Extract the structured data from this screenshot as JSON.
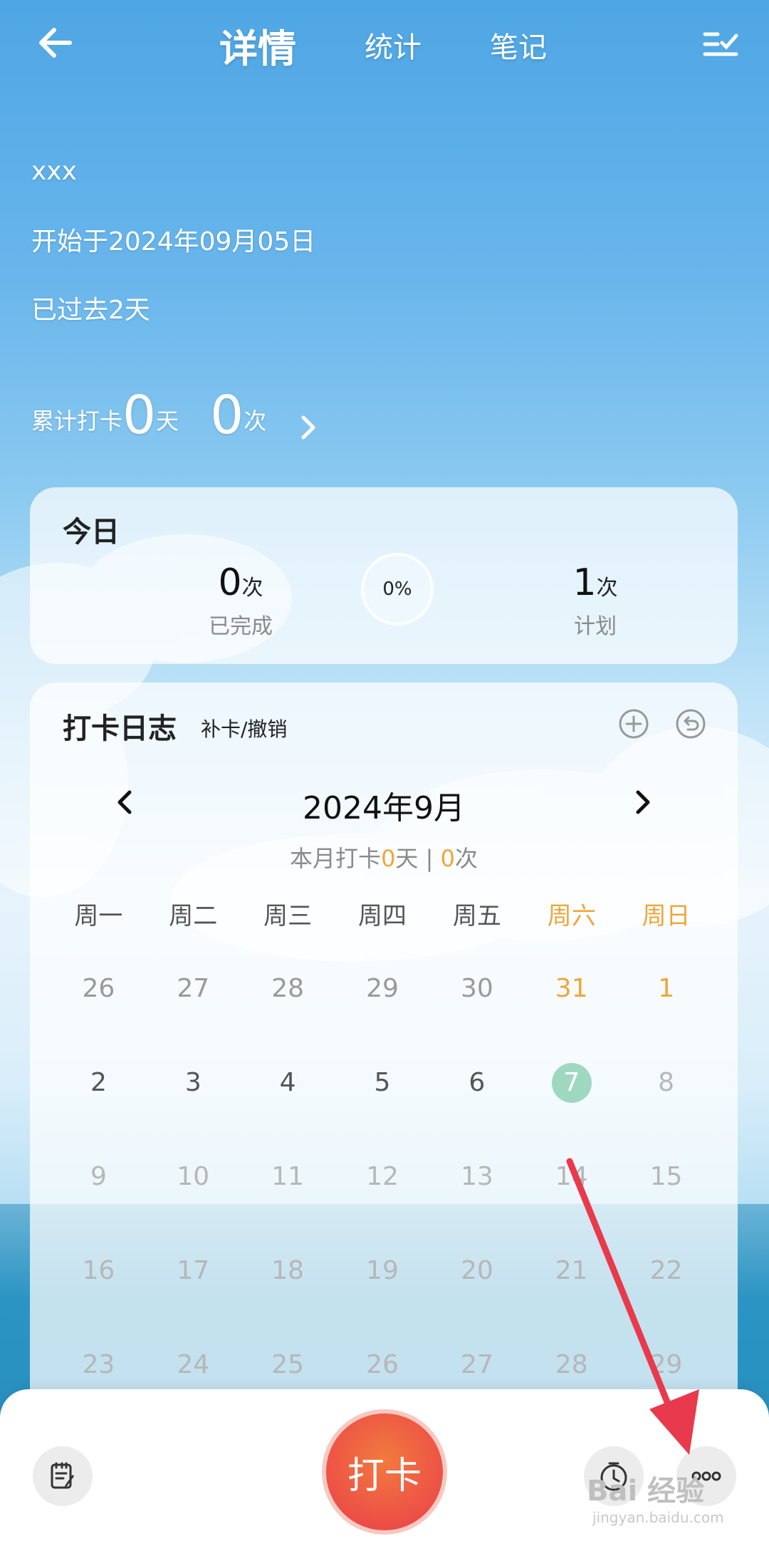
{
  "header": {
    "tabs": [
      {
        "label": "详情",
        "active": true
      },
      {
        "label": "统计",
        "active": false
      },
      {
        "label": "笔记",
        "active": false
      }
    ]
  },
  "habit": {
    "name": "xxx",
    "start_text": "开始于2024年09月05日",
    "elapsed_text": "已过去2天"
  },
  "cumulative": {
    "label": "累计打卡",
    "days": "0",
    "days_unit": "天",
    "times": "0",
    "times_unit": "次"
  },
  "today": {
    "title": "今日",
    "completed_value": "0",
    "completed_unit": "次",
    "completed_label": "已完成",
    "progress": "0%",
    "plan_value": "1",
    "plan_unit": "次",
    "plan_label": "计划"
  },
  "log": {
    "title": "打卡日志",
    "subtitle": "补卡/撤销",
    "month": "2024年9月",
    "summary_prefix": "本月打卡",
    "summary_days": "0",
    "summary_days_unit": "天 | ",
    "summary_times": "0",
    "summary_times_unit": "次",
    "weekdays": [
      "周一",
      "周二",
      "周三",
      "周四",
      "周五",
      "周六",
      "周日"
    ],
    "days": [
      {
        "d": "26",
        "type": "prev"
      },
      {
        "d": "27",
        "type": "prev"
      },
      {
        "d": "28",
        "type": "prev"
      },
      {
        "d": "29",
        "type": "prev"
      },
      {
        "d": "30",
        "type": "prev"
      },
      {
        "d": "31",
        "type": "prev"
      },
      {
        "d": "1",
        "type": "cur"
      },
      {
        "d": "2",
        "type": "cur"
      },
      {
        "d": "3",
        "type": "cur"
      },
      {
        "d": "4",
        "type": "cur"
      },
      {
        "d": "5",
        "type": "cur"
      },
      {
        "d": "6",
        "type": "cur"
      },
      {
        "d": "7",
        "type": "today"
      },
      {
        "d": "8",
        "type": "fut"
      },
      {
        "d": "9",
        "type": "fut"
      },
      {
        "d": "10",
        "type": "fut"
      },
      {
        "d": "11",
        "type": "fut"
      },
      {
        "d": "12",
        "type": "fut"
      },
      {
        "d": "13",
        "type": "fut"
      },
      {
        "d": "14",
        "type": "fut"
      },
      {
        "d": "15",
        "type": "fut"
      },
      {
        "d": "16",
        "type": "fut"
      },
      {
        "d": "17",
        "type": "fut"
      },
      {
        "d": "18",
        "type": "fut"
      },
      {
        "d": "19",
        "type": "fut"
      },
      {
        "d": "20",
        "type": "fut"
      },
      {
        "d": "21",
        "type": "fut"
      },
      {
        "d": "22",
        "type": "fut"
      },
      {
        "d": "23",
        "type": "fut"
      },
      {
        "d": "24",
        "type": "fut"
      },
      {
        "d": "25",
        "type": "fut"
      },
      {
        "d": "26",
        "type": "fut"
      },
      {
        "d": "27",
        "type": "fut"
      },
      {
        "d": "28",
        "type": "fut"
      },
      {
        "d": "29",
        "type": "fut"
      }
    ]
  },
  "bottom_bar": {
    "checkin_label": "打卡"
  },
  "watermark": {
    "brand": "Bai 经验",
    "url": "jingyan.baidu.com"
  },
  "colors": {
    "accent_weekend": "#f0a63a",
    "today_circle": "#9fd8c0",
    "checkin_start": "#f27a3e",
    "checkin_end": "#ea3d4a"
  },
  "icons": [
    "back-arrow-icon",
    "checklist-icon",
    "chevron-right-icon",
    "plus-circle-icon",
    "undo-circle-icon",
    "chevron-left-icon",
    "note-icon",
    "clock-icon",
    "more-icon"
  ]
}
